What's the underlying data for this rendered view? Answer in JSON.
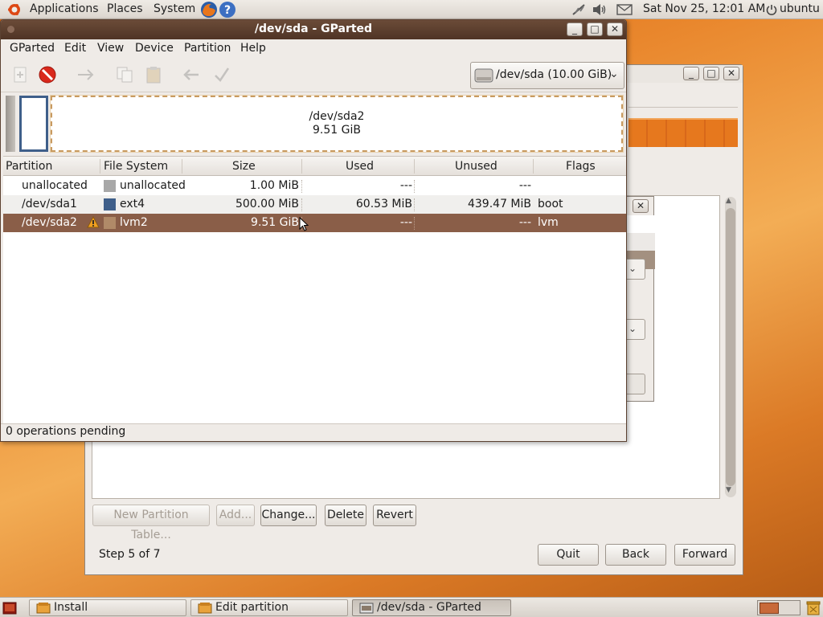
{
  "top_panel": {
    "menus": [
      "Applications",
      "Places",
      "System"
    ],
    "clock": "Sat Nov 25, 12:01 AM",
    "user": "ubuntu"
  },
  "installer": {
    "buttons": {
      "new_partition_table": "New Partition Table...",
      "add": "Add...",
      "change": "Change...",
      "delete": "Delete",
      "revert": "Revert"
    },
    "step": "Step 5 of 7",
    "quit": "Quit",
    "back": "Back",
    "forward": "Forward"
  },
  "gparted": {
    "title": "/dev/sda - GParted",
    "menu": [
      "GParted",
      "Edit",
      "View",
      "Device",
      "Partition",
      "Help"
    ],
    "device": "/dev/sda  (10.00 GiB)",
    "disk_graphic": {
      "name": "/dev/sda2",
      "size": "9.51 GiB"
    },
    "columns": [
      "Partition",
      "File System",
      "Size",
      "Used",
      "Unused",
      "Flags"
    ],
    "rows": [
      {
        "partition": "unallocated",
        "filesystem": "unallocated",
        "fs_color": "#a8a8a8",
        "size": "1.00 MiB",
        "used": "---",
        "unused": "---",
        "flags": ""
      },
      {
        "partition": "/dev/sda1",
        "filesystem": "ext4",
        "fs_color": "#3f5f8a",
        "size": "500.00 MiB",
        "used": "60.53 MiB",
        "unused": "439.47 MiB",
        "flags": "boot"
      },
      {
        "partition": "/dev/sda2",
        "filesystem": "lvm2",
        "fs_color": "#b08a68",
        "size": "9.51 GiB",
        "used": "---",
        "unused": "---",
        "flags": "lvm",
        "warning": true
      }
    ],
    "status": "0 operations pending"
  },
  "taskbar": {
    "tasks": [
      "Install",
      "Edit partition",
      "/dev/sda - GParted"
    ]
  },
  "colors": {
    "selection": "#8a5e48",
    "title_bar": "#5a3d2c",
    "accent_orange": "#e6781e"
  }
}
